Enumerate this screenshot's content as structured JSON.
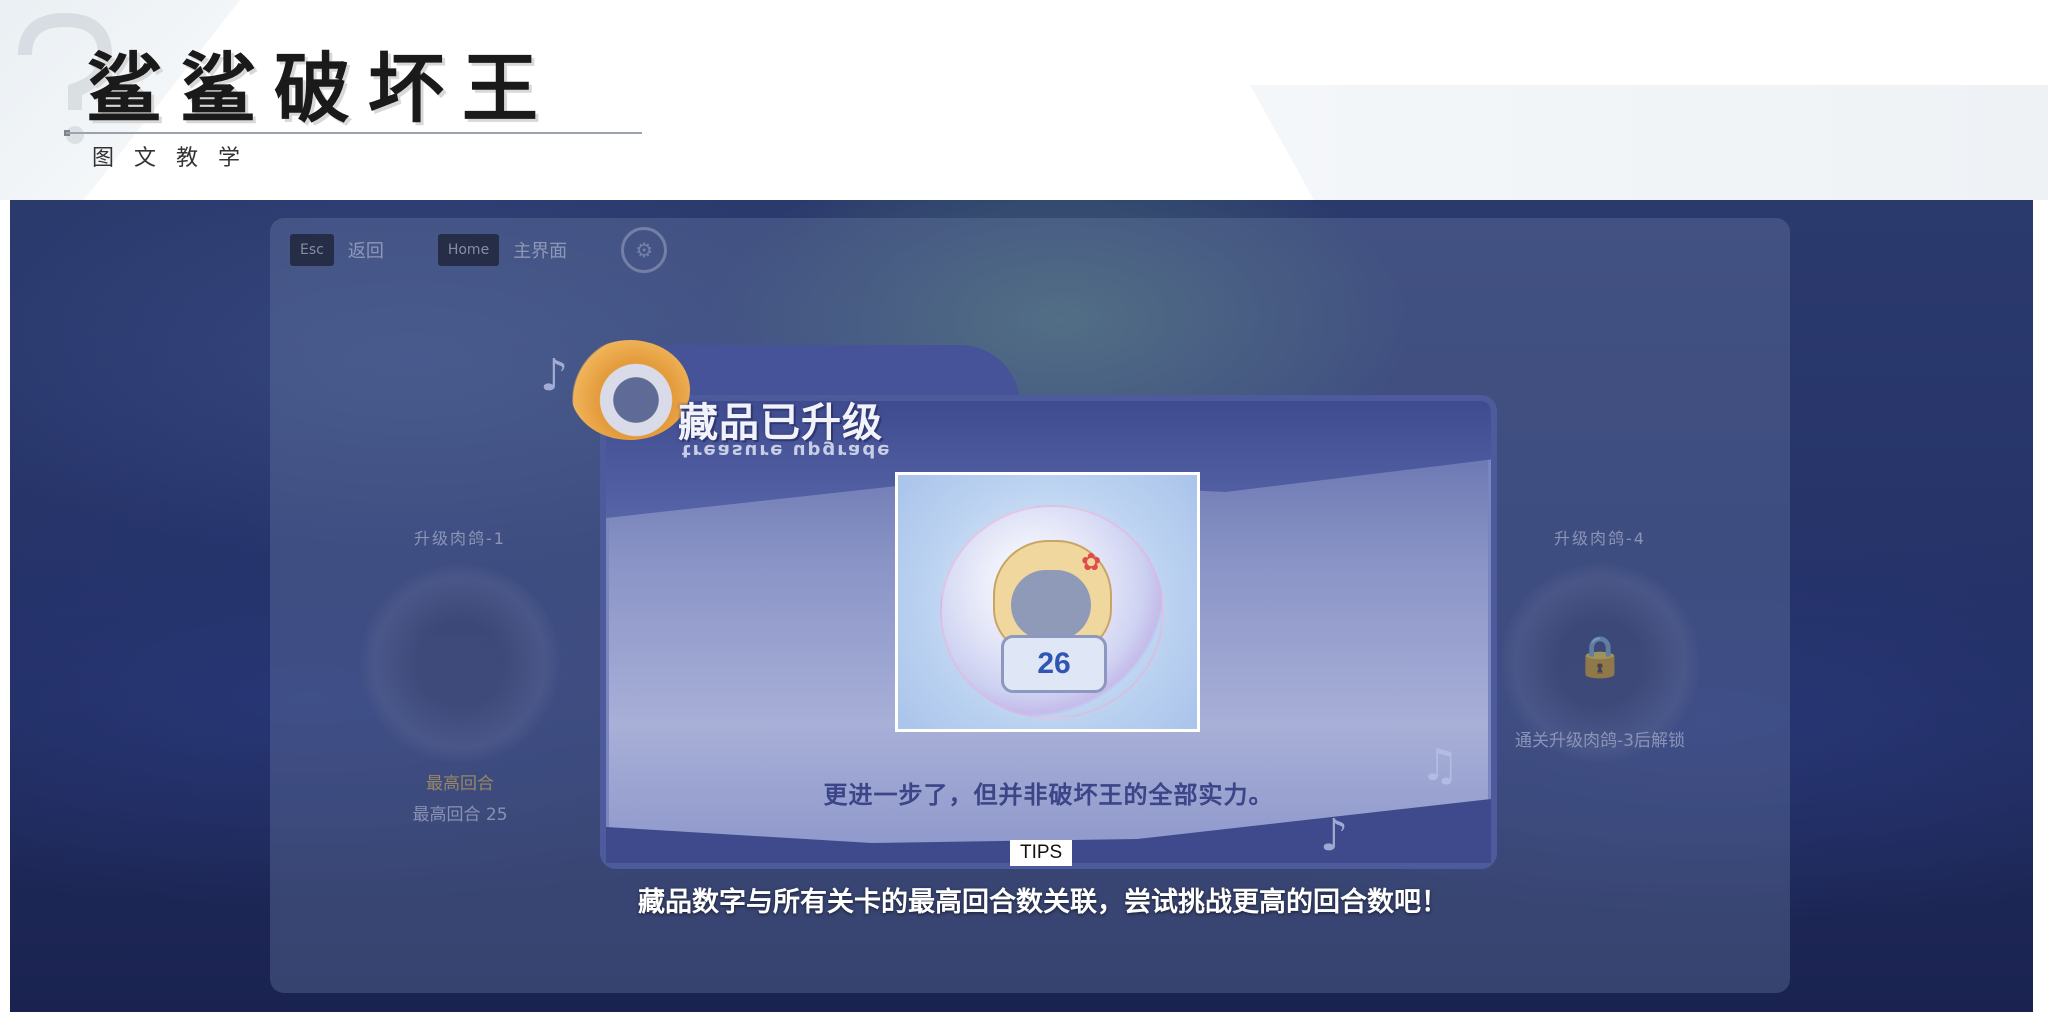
{
  "header": {
    "title": "鲨鲨破坏王",
    "subtitle": "图文教学"
  },
  "topbar": {
    "esc_key": "Esc",
    "esc_label": "返回",
    "home_key": "Home",
    "home_label": "主界面",
    "settings_icon": "gear-icon"
  },
  "background_cards": {
    "left": {
      "title": "升级肉鸽-1",
      "tag": "最高回合",
      "caption": "最高回合 25"
    },
    "right": {
      "title": "升级肉鸽-4",
      "lock_text": "通关升级肉鸽-3后解锁"
    }
  },
  "popup": {
    "title": "藏品已升级",
    "subtitle": "treasure upgrade",
    "item_number": "26",
    "description": "更进一步了，但并非破坏王的全部实力。"
  },
  "tips": {
    "tag": "TIPS",
    "text": "藏品数字与所有关卡的最高回合数关联，尝试挑战更高的回合数吧！"
  },
  "colors": {
    "screen_bg": "#26346a",
    "popup_frame": "#4d5a9c",
    "badge_number": "#2f56b5"
  }
}
